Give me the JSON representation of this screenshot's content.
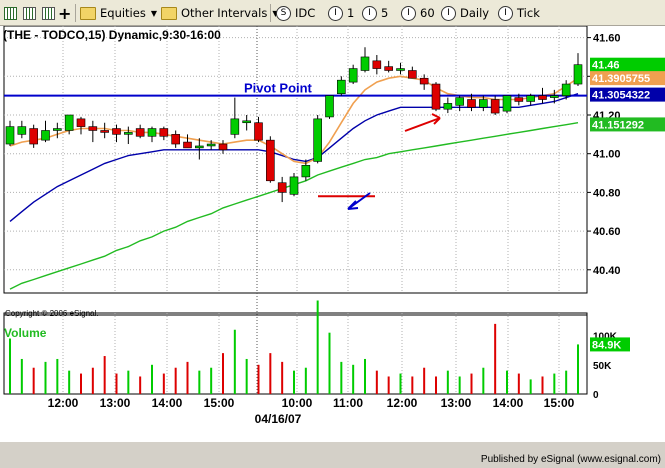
{
  "toolbar": {
    "equities_label": "Equities",
    "intervals_label": "Other Intervals",
    "s_symbol": "S",
    "idc_label": "IDC",
    "i_symbol": "I",
    "i1_label": "1",
    "i5_label": "5",
    "i60_label": "60",
    "daily_label": "Daily",
    "tick_label": "Tick"
  },
  "chart_data": {
    "type": "candlestick",
    "title": "(THE - TODCO,15) Dynamic,9:30-16:00",
    "copyright": "Copyright © 2006 eSignal.",
    "footer": "Published by eSignal (www.esignal.com)",
    "date_label": "04/16/07",
    "x_ticks": [
      "12:00",
      "13:00",
      "14:00",
      "15:00",
      "10:00",
      "11:00",
      "12:00",
      "13:00",
      "14:00",
      "15:00"
    ],
    "y_ticks": [
      "41.60",
      "41.40",
      "41.20",
      "41.00",
      "40.80",
      "40.60",
      "40.40"
    ],
    "ylim": [
      40.28,
      41.66
    ],
    "pivot": {
      "label": "Pivot Point",
      "value": 41.3
    },
    "colors": {
      "up": "#00cc00",
      "down": "#dd0000",
      "pivot": "#0000cc",
      "fast_ma": "#f0a050",
      "mid_ma": "#0000aa",
      "slow_ma": "#22bb22"
    },
    "price_labels": [
      {
        "text": "41.46",
        "value": 41.46,
        "bg": "#00cc00"
      },
      {
        "text": "41.3905755",
        "value": 41.3905755,
        "bg": "#f0a050"
      },
      {
        "text": "41.3054322",
        "value": 41.3054322,
        "bg": "#0000aa"
      },
      {
        "text": "41.151292",
        "value": 41.151292,
        "bg": "#22bb22"
      }
    ],
    "candles": [
      {
        "t": 0,
        "o": 41.05,
        "h": 41.17,
        "l": 41.04,
        "c": 41.14
      },
      {
        "t": 1,
        "o": 41.1,
        "h": 41.17,
        "l": 41.08,
        "c": 41.14
      },
      {
        "t": 2,
        "o": 41.13,
        "h": 41.15,
        "l": 41.03,
        "c": 41.05
      },
      {
        "t": 3,
        "o": 41.07,
        "h": 41.17,
        "l": 41.06,
        "c": 41.12
      },
      {
        "t": 4,
        "o": 41.12,
        "h": 41.16,
        "l": 41.08,
        "c": 41.13
      },
      {
        "t": 5,
        "o": 41.12,
        "h": 41.2,
        "l": 41.1,
        "c": 41.2
      },
      {
        "t": 6,
        "o": 41.18,
        "h": 41.19,
        "l": 41.1,
        "c": 41.14
      },
      {
        "t": 7,
        "o": 41.14,
        "h": 41.17,
        "l": 41.06,
        "c": 41.12
      },
      {
        "t": 8,
        "o": 41.12,
        "h": 41.16,
        "l": 41.08,
        "c": 41.11
      },
      {
        "t": 9,
        "o": 41.13,
        "h": 41.15,
        "l": 41.06,
        "c": 41.1
      },
      {
        "t": 10,
        "o": 41.1,
        "h": 41.14,
        "l": 41.05,
        "c": 41.11
      },
      {
        "t": 11,
        "o": 41.13,
        "h": 41.15,
        "l": 41.08,
        "c": 41.09
      },
      {
        "t": 12,
        "o": 41.09,
        "h": 41.14,
        "l": 41.06,
        "c": 41.13
      },
      {
        "t": 13,
        "o": 41.13,
        "h": 41.14,
        "l": 41.07,
        "c": 41.09
      },
      {
        "t": 14,
        "o": 41.1,
        "h": 41.12,
        "l": 41.03,
        "c": 41.05
      },
      {
        "t": 15,
        "o": 41.06,
        "h": 41.1,
        "l": 41.03,
        "c": 41.03
      },
      {
        "t": 16,
        "o": 41.03,
        "h": 41.08,
        "l": 40.97,
        "c": 41.04
      },
      {
        "t": 17,
        "o": 41.04,
        "h": 41.07,
        "l": 41.02,
        "c": 41.05
      },
      {
        "t": 18,
        "o": 41.05,
        "h": 41.07,
        "l": 41.0,
        "c": 41.02
      },
      {
        "t": 19,
        "o": 41.1,
        "h": 41.29,
        "l": 41.08,
        "c": 41.18
      },
      {
        "t": 20,
        "o": 41.16,
        "h": 41.2,
        "l": 41.12,
        "c": 41.17
      },
      {
        "t": 21,
        "o": 41.16,
        "h": 41.19,
        "l": 41.06,
        "c": 41.07
      },
      {
        "t": 22,
        "o": 41.07,
        "h": 41.09,
        "l": 40.85,
        "c": 40.86
      },
      {
        "t": 23,
        "o": 40.85,
        "h": 40.88,
        "l": 40.75,
        "c": 40.8
      },
      {
        "t": 24,
        "o": 40.79,
        "h": 40.9,
        "l": 40.78,
        "c": 40.88
      },
      {
        "t": 25,
        "o": 40.88,
        "h": 40.97,
        "l": 40.86,
        "c": 40.94
      },
      {
        "t": 26,
        "o": 40.96,
        "h": 41.2,
        "l": 40.95,
        "c": 41.18
      },
      {
        "t": 27,
        "o": 41.19,
        "h": 41.3,
        "l": 41.18,
        "c": 41.3
      },
      {
        "t": 28,
        "o": 41.31,
        "h": 41.4,
        "l": 41.3,
        "c": 41.38
      },
      {
        "t": 29,
        "o": 41.37,
        "h": 41.46,
        "l": 41.36,
        "c": 41.44
      },
      {
        "t": 30,
        "o": 41.43,
        "h": 41.55,
        "l": 41.42,
        "c": 41.5
      },
      {
        "t": 31,
        "o": 41.48,
        "h": 41.51,
        "l": 41.41,
        "c": 41.44
      },
      {
        "t": 32,
        "o": 41.45,
        "h": 41.48,
        "l": 41.42,
        "c": 41.43
      },
      {
        "t": 33,
        "o": 41.43,
        "h": 41.47,
        "l": 41.41,
        "c": 41.44
      },
      {
        "t": 34,
        "o": 41.43,
        "h": 41.45,
        "l": 41.39,
        "c": 41.39
      },
      {
        "t": 35,
        "o": 41.39,
        "h": 41.41,
        "l": 41.33,
        "c": 41.36
      },
      {
        "t": 36,
        "o": 41.36,
        "h": 41.37,
        "l": 41.22,
        "c": 41.23
      },
      {
        "t": 37,
        "o": 41.23,
        "h": 41.29,
        "l": 41.21,
        "c": 41.26
      },
      {
        "t": 38,
        "o": 41.25,
        "h": 41.3,
        "l": 41.22,
        "c": 41.29
      },
      {
        "t": 39,
        "o": 41.28,
        "h": 41.31,
        "l": 41.22,
        "c": 41.24
      },
      {
        "t": 40,
        "o": 41.24,
        "h": 41.3,
        "l": 41.22,
        "c": 41.28
      },
      {
        "t": 41,
        "o": 41.28,
        "h": 41.3,
        "l": 41.2,
        "c": 41.21
      },
      {
        "t": 42,
        "o": 41.22,
        "h": 41.3,
        "l": 41.21,
        "c": 41.3
      },
      {
        "t": 43,
        "o": 41.29,
        "h": 41.31,
        "l": 41.25,
        "c": 41.27
      },
      {
        "t": 44,
        "o": 41.27,
        "h": 41.31,
        "l": 41.25,
        "c": 41.3
      },
      {
        "t": 45,
        "o": 41.3,
        "h": 41.34,
        "l": 41.26,
        "c": 41.28
      },
      {
        "t": 46,
        "o": 41.29,
        "h": 41.33,
        "l": 41.26,
        "c": 41.3
      },
      {
        "t": 47,
        "o": 41.3,
        "h": 41.38,
        "l": 41.28,
        "c": 41.36
      },
      {
        "t": 48,
        "o": 41.36,
        "h": 41.52,
        "l": 41.35,
        "c": 41.46
      }
    ],
    "ma_fast": [
      41.04,
      41.06,
      41.07,
      41.08,
      41.1,
      41.12,
      41.13,
      41.13,
      41.13,
      41.12,
      41.12,
      41.11,
      41.11,
      41.1,
      41.09,
      41.08,
      41.07,
      41.06,
      41.05,
      41.06,
      41.07,
      41.07,
      41.04,
      41.0,
      40.96,
      40.95,
      40.98,
      41.06,
      41.16,
      41.26,
      41.33,
      41.37,
      41.39,
      41.4,
      41.39,
      41.38,
      41.34,
      41.31,
      41.3,
      41.29,
      41.29,
      41.28,
      41.28,
      41.28,
      41.29,
      41.3,
      41.31,
      41.35,
      41.39
    ],
    "ma_mid": [
      40.65,
      40.7,
      40.75,
      40.79,
      40.83,
      40.86,
      40.89,
      40.92,
      40.95,
      40.97,
      40.99,
      41.0,
      41.01,
      41.02,
      41.02,
      41.02,
      41.02,
      41.02,
      41.02,
      41.02,
      41.02,
      41.02,
      41.01,
      40.99,
      40.97,
      40.96,
      40.98,
      41.03,
      41.08,
      41.13,
      41.17,
      41.2,
      41.22,
      41.24,
      41.24,
      41.24,
      41.24,
      41.24,
      41.24,
      41.24,
      41.24,
      41.24,
      41.24,
      41.24,
      41.25,
      41.26,
      41.27,
      41.29,
      41.31
    ],
    "ma_slow": [
      40.3,
      40.33,
      40.35,
      40.37,
      40.39,
      40.41,
      40.43,
      40.45,
      40.47,
      40.5,
      40.52,
      40.55,
      40.57,
      40.6,
      40.62,
      40.65,
      40.67,
      40.69,
      40.72,
      40.74,
      40.76,
      40.78,
      40.8,
      40.82,
      40.84,
      40.86,
      40.89,
      40.91,
      40.93,
      40.95,
      40.97,
      40.98,
      41.0,
      41.01,
      41.02,
      41.03,
      41.04,
      41.05,
      41.06,
      41.07,
      41.08,
      41.09,
      41.1,
      41.11,
      41.12,
      41.13,
      41.14,
      41.15,
      41.16
    ],
    "volume": {
      "title": "Volume",
      "last_label": "84.9K",
      "last_value": 84900,
      "tick_labels": [
        "100K",
        "50K",
        "0"
      ],
      "ylim": [
        0,
        125000
      ],
      "values": [
        95000,
        60000,
        45000,
        55000,
        60000,
        40000,
        35000,
        45000,
        65000,
        35000,
        40000,
        30000,
        50000,
        35000,
        45000,
        55000,
        40000,
        45000,
        70000,
        110000,
        60000,
        50000,
        70000,
        55000,
        40000,
        45000,
        160000,
        105000,
        55000,
        50000,
        60000,
        40000,
        30000,
        35000,
        30000,
        45000,
        30000,
        40000,
        30000,
        35000,
        45000,
        120000,
        40000,
        35000,
        25000,
        30000,
        35000,
        40000,
        84900
      ]
    }
  }
}
